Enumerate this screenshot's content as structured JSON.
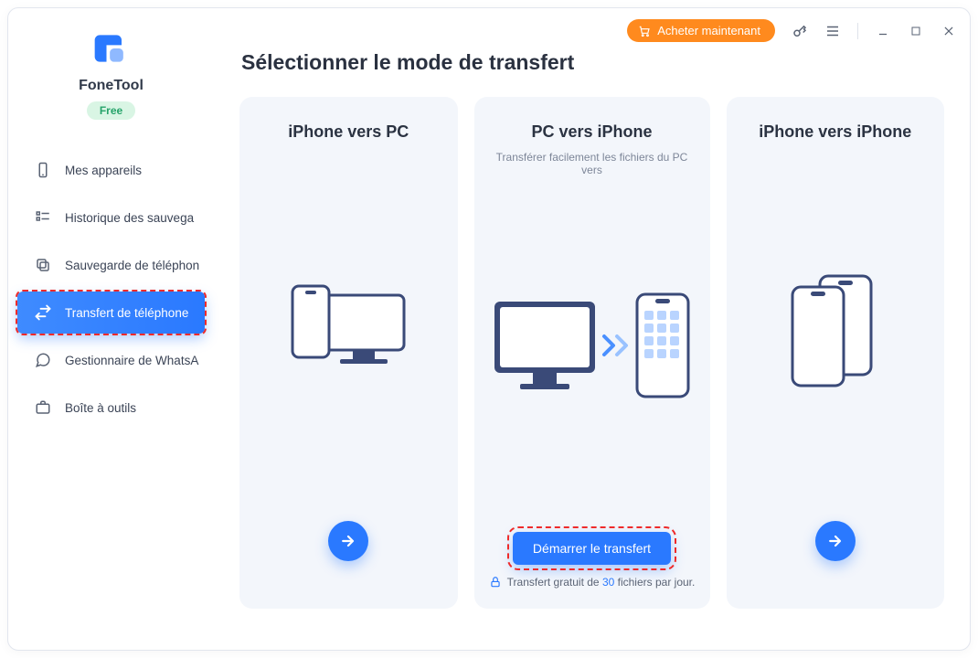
{
  "brand": {
    "name": "FoneTool",
    "plan": "Free"
  },
  "header": {
    "buy_label": "Acheter maintenant"
  },
  "sidebar": {
    "items": [
      {
        "label": "Mes appareils"
      },
      {
        "label": "Historique des sauvega"
      },
      {
        "label": "Sauvegarde de téléphon"
      },
      {
        "label": "Transfert de téléphone"
      },
      {
        "label": "Gestionnaire de WhatsA"
      },
      {
        "label": "Boîte à outils"
      }
    ]
  },
  "page": {
    "title": "Sélectionner le mode de transfert"
  },
  "cards": [
    {
      "title": "iPhone vers PC",
      "subtitle": ""
    },
    {
      "title": "PC vers iPhone",
      "subtitle": "Transférer facilement les fichiers du PC vers",
      "cta": "Démarrer le transfert",
      "footer_prefix": "Transfert gratuit de ",
      "footer_num": "30",
      "footer_suffix": " fichiers par jour."
    },
    {
      "title": "iPhone vers iPhone",
      "subtitle": ""
    }
  ]
}
